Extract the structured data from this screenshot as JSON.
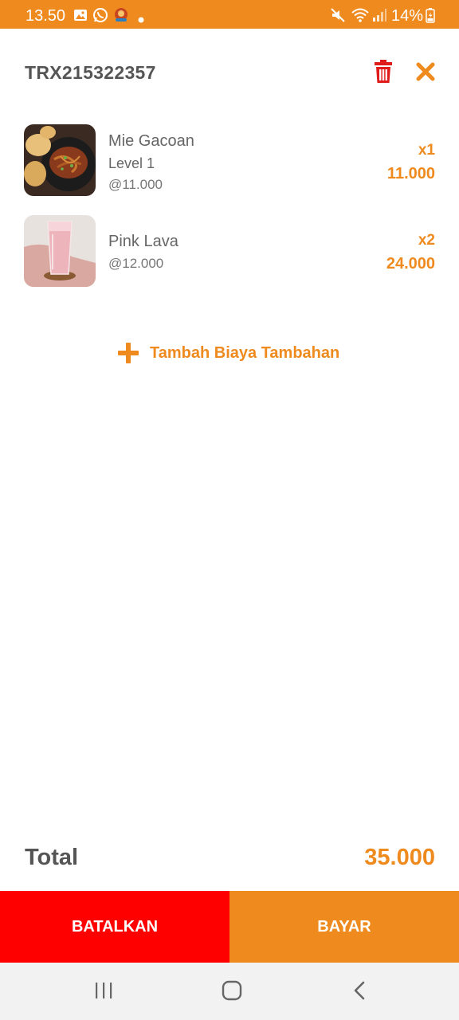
{
  "status_bar": {
    "time": "13.50",
    "battery": "14%",
    "icons": [
      "gallery-icon",
      "whatsapp-icon",
      "app-icon",
      "dot-icon",
      "mute-icon",
      "wifi-icon",
      "signal-icon",
      "battery-icon"
    ]
  },
  "header": {
    "transaction_id": "TRX215322357",
    "delete_icon": "trash-icon",
    "close_icon": "close-icon"
  },
  "items": [
    {
      "name": "Mie Gacoan",
      "variant": "Level 1",
      "unit_price": "@11.000",
      "quantity": "x1",
      "subtotal": "11.000",
      "image": "noodle-dish-image"
    },
    {
      "name": "Pink Lava",
      "variant": "",
      "unit_price": "@12.000",
      "quantity": "x2",
      "subtotal": "24.000",
      "image": "pink-drink-image"
    }
  ],
  "add_fee": {
    "label": "Tambah Biaya Tambahan",
    "icon": "plus-icon"
  },
  "total": {
    "label": "Total",
    "value": "35.000"
  },
  "actions": {
    "cancel_label": "BATALKAN",
    "pay_label": "BAYAR"
  },
  "nav_bar": {
    "icons": [
      "recent-apps-icon",
      "home-icon",
      "back-icon"
    ]
  },
  "colors": {
    "accent": "#EE8A1E",
    "danger": "#FF0000",
    "text": "#555555"
  }
}
